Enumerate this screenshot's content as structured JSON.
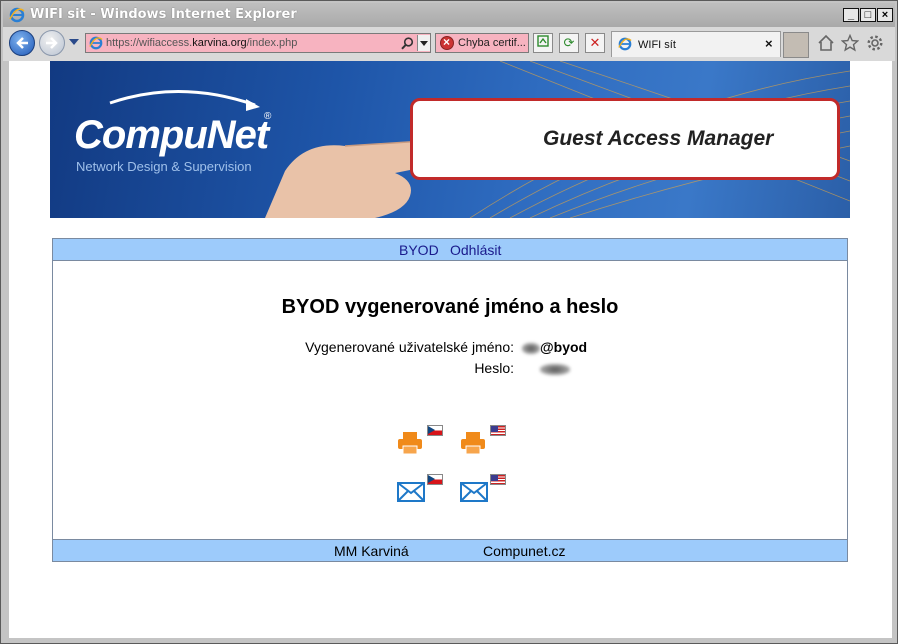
{
  "window": {
    "title": "WIFI sit - Windows Internet Explorer",
    "min_label": "_",
    "max_label": "□",
    "close_label": "×"
  },
  "toolbar": {
    "url_prefix": "https://wifiaccess.",
    "url_domain": "karvina.org",
    "url_suffix": "/index.php",
    "cert_error": "Chyba certif...",
    "tab_title": "WIFI sít",
    "tab_close": "×",
    "refresh_label": "⟳",
    "stop_label": "✕"
  },
  "banner": {
    "logo": "CompuNet",
    "logo_reg": "®",
    "logo_sub": "Network Design & Supervision",
    "product": "Guest Access Manager"
  },
  "nav": {
    "byod": "BYOD",
    "logout": "Odhlásit"
  },
  "main": {
    "heading": "BYOD vygenerované jméno a heslo",
    "username_label": "Vygenerované uživatelské jméno:",
    "username_value_suffix": "@byod",
    "password_label": "Heslo:"
  },
  "footer": {
    "left": "MM Karviná",
    "right": "Compunet.cz"
  },
  "colors": {
    "bar": "#9dcbfb",
    "link": "#1a1a8c",
    "address_bar_error": "#f7b3c0",
    "printer": "#f08a1a",
    "envelope": "#1e78c8"
  }
}
